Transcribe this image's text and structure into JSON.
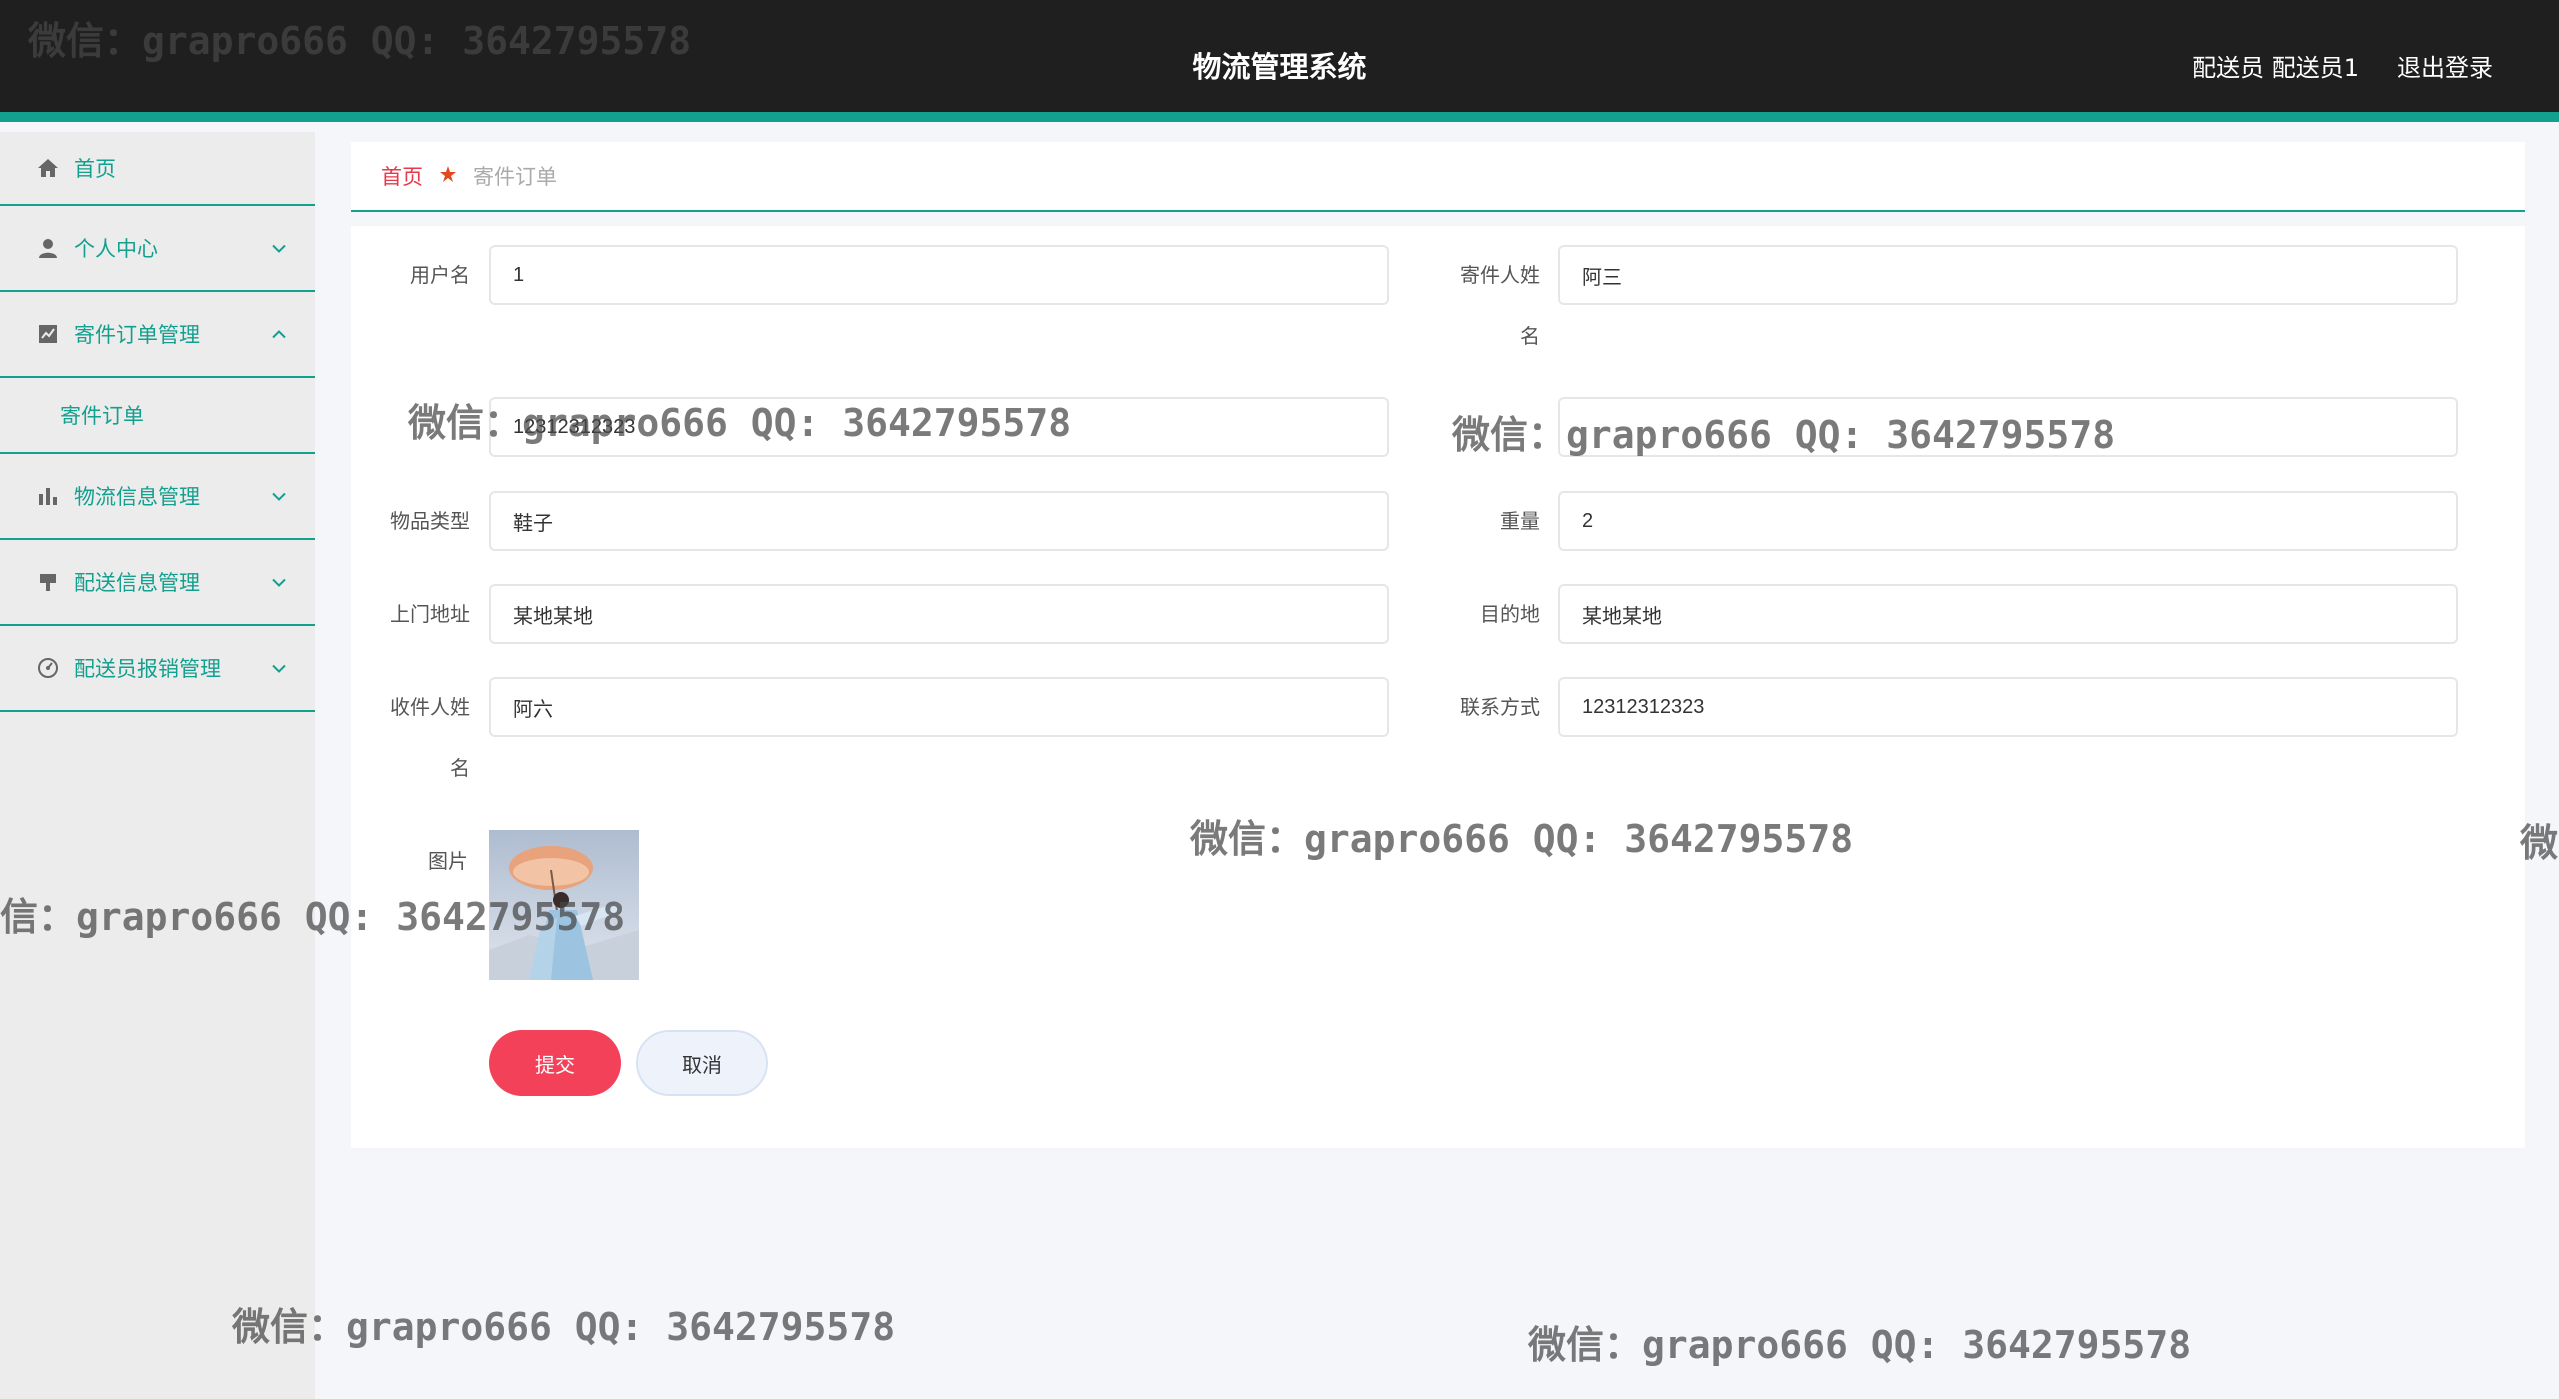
{
  "header": {
    "title": "物流管理系统",
    "user": "配送员 配送员1",
    "logout": "退出登录"
  },
  "sidebar": {
    "items": [
      {
        "label": "首页",
        "icon": "home-icon"
      },
      {
        "label": "个人中心",
        "icon": "user-icon"
      },
      {
        "label": "寄件订单管理",
        "icon": "chart-icon"
      },
      {
        "label": "寄件订单",
        "icon": ""
      },
      {
        "label": "物流信息管理",
        "icon": "bar-chart-icon"
      },
      {
        "label": "配送信息管理",
        "icon": "flag-icon"
      },
      {
        "label": "配送员报销管理",
        "icon": "gauge-icon"
      }
    ]
  },
  "breadcrumb": {
    "home": "首页",
    "current": "寄件订单"
  },
  "form": {
    "username_label": "用户名",
    "username": "1",
    "sender_name_label_1": "寄件人姓",
    "sender_name_label_2": "名",
    "sender_name": "阿三",
    "phone_value": "12312312323",
    "item_type_label": "物品类型",
    "item_type": "鞋子",
    "weight_label": "重量",
    "weight": "2",
    "pickup_label": "上门地址",
    "pickup": "某地某地",
    "destination_label": "目的地",
    "destination": "某地某地",
    "receiver_label_1": "收件人姓",
    "receiver_label_2": "名",
    "receiver": "阿六",
    "contact_label": "联系方式",
    "contact": "12312312323",
    "picture_label": "图片",
    "submit": "提交",
    "cancel": "取消"
  },
  "watermarks": [
    "微信：grapro666 QQ: 3642795578",
    "微信：grapro666 QQ: 3642795578",
    "微信：grapro666 QQ: 3642795578",
    "微信：grapro666 QQ: 3642795578",
    "信：grapro666 QQ: 3642795578",
    "微",
    "微信：grapro666 QQ: 3642795578",
    "微信：grapro666 QQ: 3642795578"
  ],
  "colors": {
    "accent": "#14a08e",
    "primary_button": "#f4415a",
    "header_bg": "#1f1f1f"
  }
}
